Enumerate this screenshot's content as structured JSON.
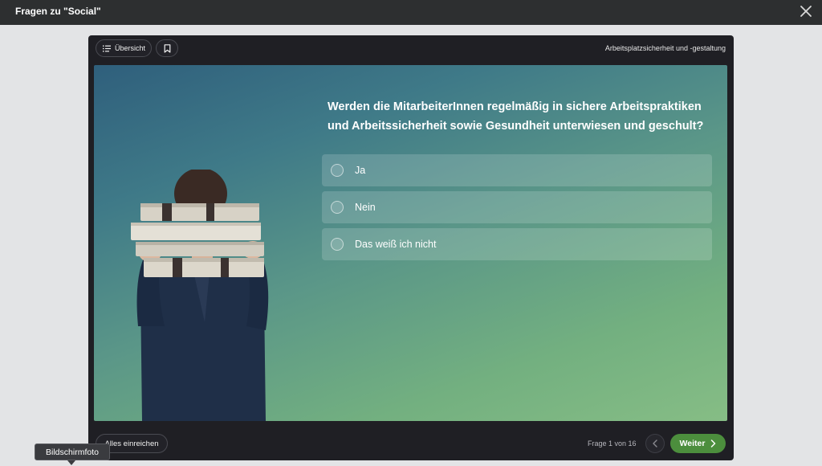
{
  "window": {
    "title": "Fragen zu \"Social\"",
    "close_icon": "close-icon"
  },
  "toolbar": {
    "overview_label": "Übersicht",
    "overview_icon": "list-icon",
    "bookmark_icon": "bookmark-icon",
    "topic": "Arbeitsplatzsicherheit und -gestaltung"
  },
  "question": {
    "text": "Werden die MitarbeiterInnen regelmäßig in sichere Arbeitspraktiken und Arbeitssicherheit sowie Gesundheit unterwiesen und geschult?",
    "answers": [
      {
        "label": "Ja",
        "selected": false
      },
      {
        "label": "Nein",
        "selected": false
      },
      {
        "label": "Das weiß ich nicht",
        "selected": false
      }
    ]
  },
  "footer": {
    "submit_label": "Alles einreichen",
    "progress": "Frage 1 von 16",
    "next_label": "Weiter",
    "prev_icon": "chevron-left-icon",
    "next_icon": "chevron-right-icon"
  },
  "tooltip": {
    "text": "Bildschirmfoto"
  },
  "colors": {
    "accent_green": "#4c8e3d",
    "modal_bg": "#1f1f24",
    "topbar_bg": "#2d2f30"
  }
}
